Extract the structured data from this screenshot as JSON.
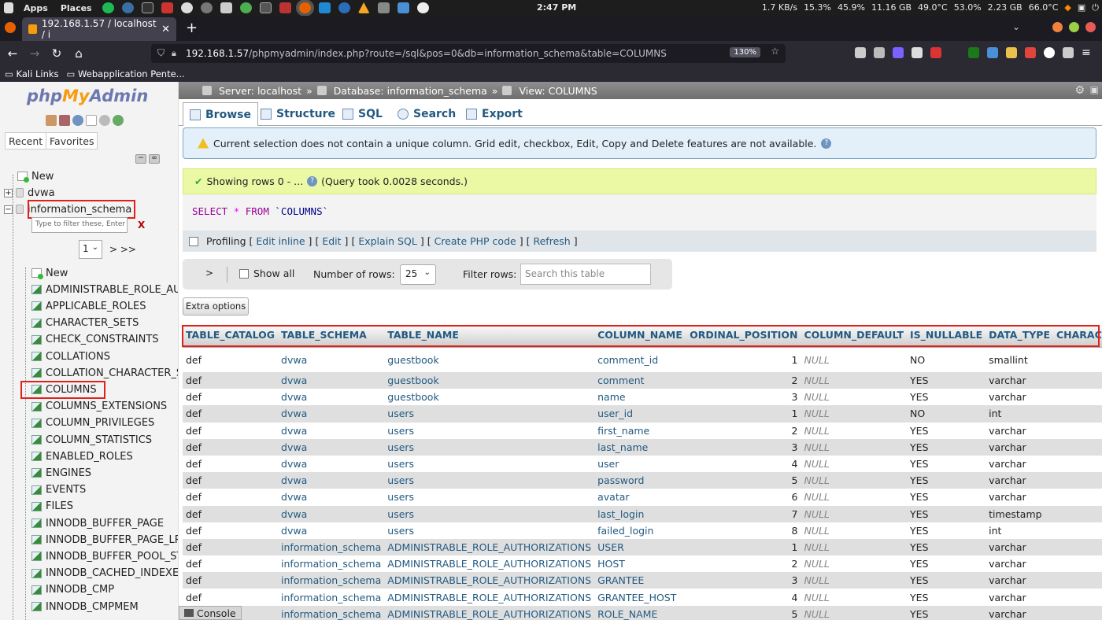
{
  "os": {
    "apps": "Apps",
    "places": "Places",
    "clock": "2:47 PM",
    "stats": [
      "1.7 KB/s",
      "15.3%",
      "45.9%",
      "11.16 GB",
      "49.0°C",
      "53.0%",
      "2.23 GB",
      "66.0°C"
    ]
  },
  "browser": {
    "tab_title": "192.168.1.57 / localhost / i",
    "url_host": "192.168.1.57",
    "url_path": "/phpmyadmin/index.php?route=/sql&pos=0&db=information_schema&table=COLUMNS",
    "zoom": "130%",
    "bookmarks": [
      "Kali Links",
      "Webapplication Pente..."
    ]
  },
  "sidebar": {
    "logo_php": "php",
    "logo_my": "My",
    "logo_admin": "Admin",
    "recent": "Recent",
    "favorites": "Favorites",
    "databases": [
      "New",
      "dvwa",
      "information_schema"
    ],
    "filter_placeholder": "Type to filter these, Enter to",
    "filter_clear": "X",
    "page": "1",
    "page_next": "> >>",
    "tables": [
      "New",
      "ADMINISTRABLE_ROLE_AUTHORIZATIONS",
      "APPLICABLE_ROLES",
      "CHARACTER_SETS",
      "CHECK_CONSTRAINTS",
      "COLLATIONS",
      "COLLATION_CHARACTER_SET_APPLICABILITY",
      "COLUMNS",
      "COLUMNS_EXTENSIONS",
      "COLUMN_PRIVILEGES",
      "COLUMN_STATISTICS",
      "ENABLED_ROLES",
      "ENGINES",
      "EVENTS",
      "FILES",
      "INNODB_BUFFER_PAGE",
      "INNODB_BUFFER_PAGE_LRU",
      "INNODB_BUFFER_POOL_STATS",
      "INNODB_CACHED_INDEXES",
      "INNODB_CMP",
      "INNODB_CMPMEM"
    ]
  },
  "breadcrumb": {
    "server": "Server: localhost",
    "database": "Database: information_schema",
    "view": "View: COLUMNS"
  },
  "tabs": [
    "Browse",
    "Structure",
    "SQL",
    "Search",
    "Export"
  ],
  "notice": "Current selection does not contain a unique column. Grid edit, checkbox, Edit, Copy and Delete features are not available.",
  "success": {
    "showing": "Showing rows 0 - ...",
    "query_time": "(Query took 0.0028 seconds.)"
  },
  "sql": {
    "select": "SELECT",
    "star": "*",
    "from": "FROM",
    "table": "`COLUMNS`"
  },
  "profiling": {
    "label": "Profiling",
    "links": [
      "Edit inline",
      "Edit",
      "Explain SQL",
      "Create PHP code",
      "Refresh"
    ]
  },
  "nav": {
    "next": ">",
    "show_all": "Show all",
    "num_rows_label": "Number of rows:",
    "num_rows": "25",
    "filter_label": "Filter rows:",
    "filter_placeholder": "Search this table"
  },
  "extra_options": "Extra options",
  "console": "Console",
  "table": {
    "headers": [
      "TABLE_CATALOG",
      "TABLE_SCHEMA",
      "TABLE_NAME",
      "COLUMN_NAME",
      "ORDINAL_POSITION",
      "COLUMN_DEFAULT",
      "IS_NULLABLE",
      "DATA_TYPE",
      "CHARACTER_M"
    ],
    "rows": [
      [
        "def",
        "dvwa",
        "guestbook",
        "comment_id",
        "1",
        "NULL",
        "NO",
        "smallint",
        ""
      ],
      [
        "def",
        "dvwa",
        "guestbook",
        "comment",
        "2",
        "NULL",
        "YES",
        "varchar",
        ""
      ],
      [
        "def",
        "dvwa",
        "guestbook",
        "name",
        "3",
        "NULL",
        "YES",
        "varchar",
        ""
      ],
      [
        "def",
        "dvwa",
        "users",
        "user_id",
        "1",
        "NULL",
        "NO",
        "int",
        ""
      ],
      [
        "def",
        "dvwa",
        "users",
        "first_name",
        "2",
        "NULL",
        "YES",
        "varchar",
        ""
      ],
      [
        "def",
        "dvwa",
        "users",
        "last_name",
        "3",
        "NULL",
        "YES",
        "varchar",
        ""
      ],
      [
        "def",
        "dvwa",
        "users",
        "user",
        "4",
        "NULL",
        "YES",
        "varchar",
        ""
      ],
      [
        "def",
        "dvwa",
        "users",
        "password",
        "5",
        "NULL",
        "YES",
        "varchar",
        ""
      ],
      [
        "def",
        "dvwa",
        "users",
        "avatar",
        "6",
        "NULL",
        "YES",
        "varchar",
        ""
      ],
      [
        "def",
        "dvwa",
        "users",
        "last_login",
        "7",
        "NULL",
        "YES",
        "timestamp",
        ""
      ],
      [
        "def",
        "dvwa",
        "users",
        "failed_login",
        "8",
        "NULL",
        "YES",
        "int",
        ""
      ],
      [
        "def",
        "information_schema",
        "ADMINISTRABLE_ROLE_AUTHORIZATIONS",
        "USER",
        "1",
        "NULL",
        "YES",
        "varchar",
        ""
      ],
      [
        "def",
        "information_schema",
        "ADMINISTRABLE_ROLE_AUTHORIZATIONS",
        "HOST",
        "2",
        "NULL",
        "YES",
        "varchar",
        ""
      ],
      [
        "def",
        "information_schema",
        "ADMINISTRABLE_ROLE_AUTHORIZATIONS",
        "GRANTEE",
        "3",
        "NULL",
        "YES",
        "varchar",
        ""
      ],
      [
        "def",
        "information_schema",
        "ADMINISTRABLE_ROLE_AUTHORIZATIONS",
        "GRANTEE_HOST",
        "4",
        "NULL",
        "YES",
        "varchar",
        ""
      ],
      [
        "def",
        "information_schema",
        "ADMINISTRABLE_ROLE_AUTHORIZATIONS",
        "ROLE_NAME",
        "5",
        "NULL",
        "YES",
        "varchar",
        ""
      ]
    ]
  }
}
